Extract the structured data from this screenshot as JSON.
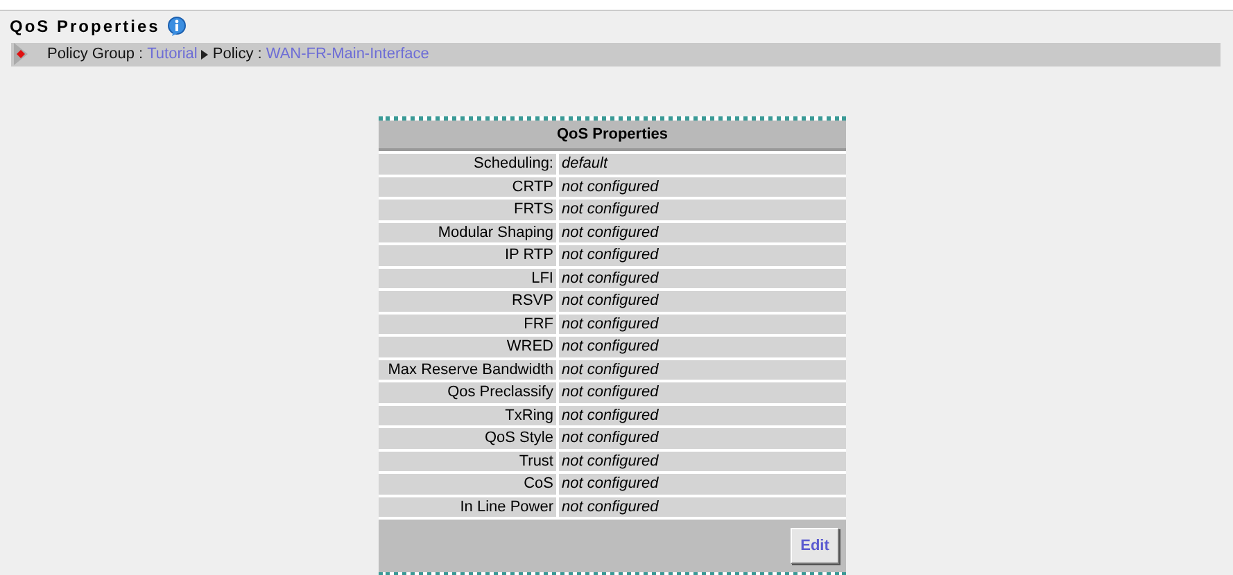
{
  "page_title": "QoS Properties",
  "breadcrumb": [
    {
      "kind": "label",
      "text": "Policy Group :"
    },
    {
      "kind": "link",
      "text": "Tutorial"
    },
    {
      "kind": "separator"
    },
    {
      "kind": "label",
      "text": "Policy :"
    },
    {
      "kind": "link",
      "text": "WAN-FR-Main-Interface"
    }
  ],
  "panel": {
    "title": "QoS Properties",
    "rows": [
      {
        "label": "Scheduling:",
        "value": "default"
      },
      {
        "label": "CRTP",
        "value": "not configured"
      },
      {
        "label": "FRTS",
        "value": "not configured"
      },
      {
        "label": "Modular Shaping",
        "value": "not configured"
      },
      {
        "label": "IP RTP",
        "value": "not configured"
      },
      {
        "label": "LFI",
        "value": "not configured"
      },
      {
        "label": "RSVP",
        "value": "not configured"
      },
      {
        "label": "FRF",
        "value": "not configured"
      },
      {
        "label": "WRED",
        "value": "not configured"
      },
      {
        "label": "Max Reserve Bandwidth",
        "value": "not configured"
      },
      {
        "label": "Qos Preclassify",
        "value": "not configured"
      },
      {
        "label": "TxRing",
        "value": "not configured"
      },
      {
        "label": "QoS Style",
        "value": "not configured"
      },
      {
        "label": "Trust",
        "value": "not configured"
      },
      {
        "label": "CoS",
        "value": "not configured"
      },
      {
        "label": "In Line Power",
        "value": "not configured"
      }
    ],
    "buttons": [
      "Edit"
    ]
  }
}
